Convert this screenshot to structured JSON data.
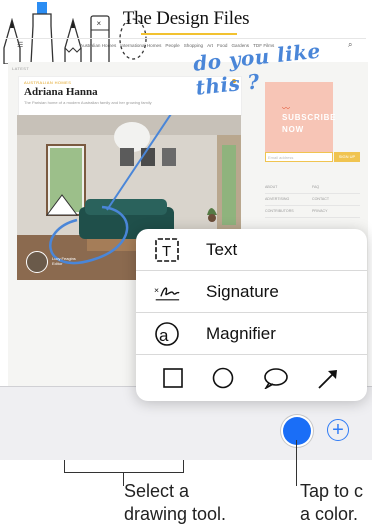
{
  "site": {
    "title": "The Design Files",
    "nav_items": [
      "Australian Homes",
      "International Homes",
      "People",
      "Shopping",
      "Art",
      "Food",
      "Gardens",
      "TDF Films"
    ],
    "latest_tag": "LATEST"
  },
  "article": {
    "tag": "AUSTRALIAN HOMES",
    "title": "Adriana Hanna",
    "subtitle": "The Parisian home of a modern Australian family and her growing family"
  },
  "author": {
    "line1": "Lucy Feagins",
    "line2": "Editor"
  },
  "sidebar": {
    "subscribe_line1": "SUBSCRIBE",
    "subscribe_line2": "NOW",
    "email_placeholder": "Email address",
    "signup_label": "SIGN UP",
    "links": [
      [
        "ABOUT",
        "FAQ"
      ],
      [
        "ADVERTISING",
        "CONTACT"
      ],
      [
        "CONTRIBUTORS",
        "PRIVACY"
      ]
    ]
  },
  "annotation": {
    "handwriting": "do you like this ?"
  },
  "popup": {
    "items": [
      {
        "label": "Text",
        "icon": "text-box-icon"
      },
      {
        "label": "Signature",
        "icon": "signature-icon"
      },
      {
        "label": "Magnifier",
        "icon": "magnifier-icon"
      }
    ],
    "shapes": [
      "square-icon",
      "circle-icon",
      "speech-bubble-icon",
      "arrow-icon"
    ]
  },
  "toolbar": {
    "tools": [
      "pen-icon",
      "highlighter-icon",
      "pencil-icon",
      "eraser-icon",
      "lasso-icon"
    ],
    "selected_color": "#1a6ef7",
    "add_symbol": "+"
  },
  "callouts": {
    "tool_line1": "Select a",
    "tool_line2": "drawing tool.",
    "color_line1": "Tap to c",
    "color_line2": "a color."
  },
  "colors": {
    "accent": "#f2c230",
    "annotation": "#4a86d8",
    "toolbar_bg": "#efeff2"
  }
}
